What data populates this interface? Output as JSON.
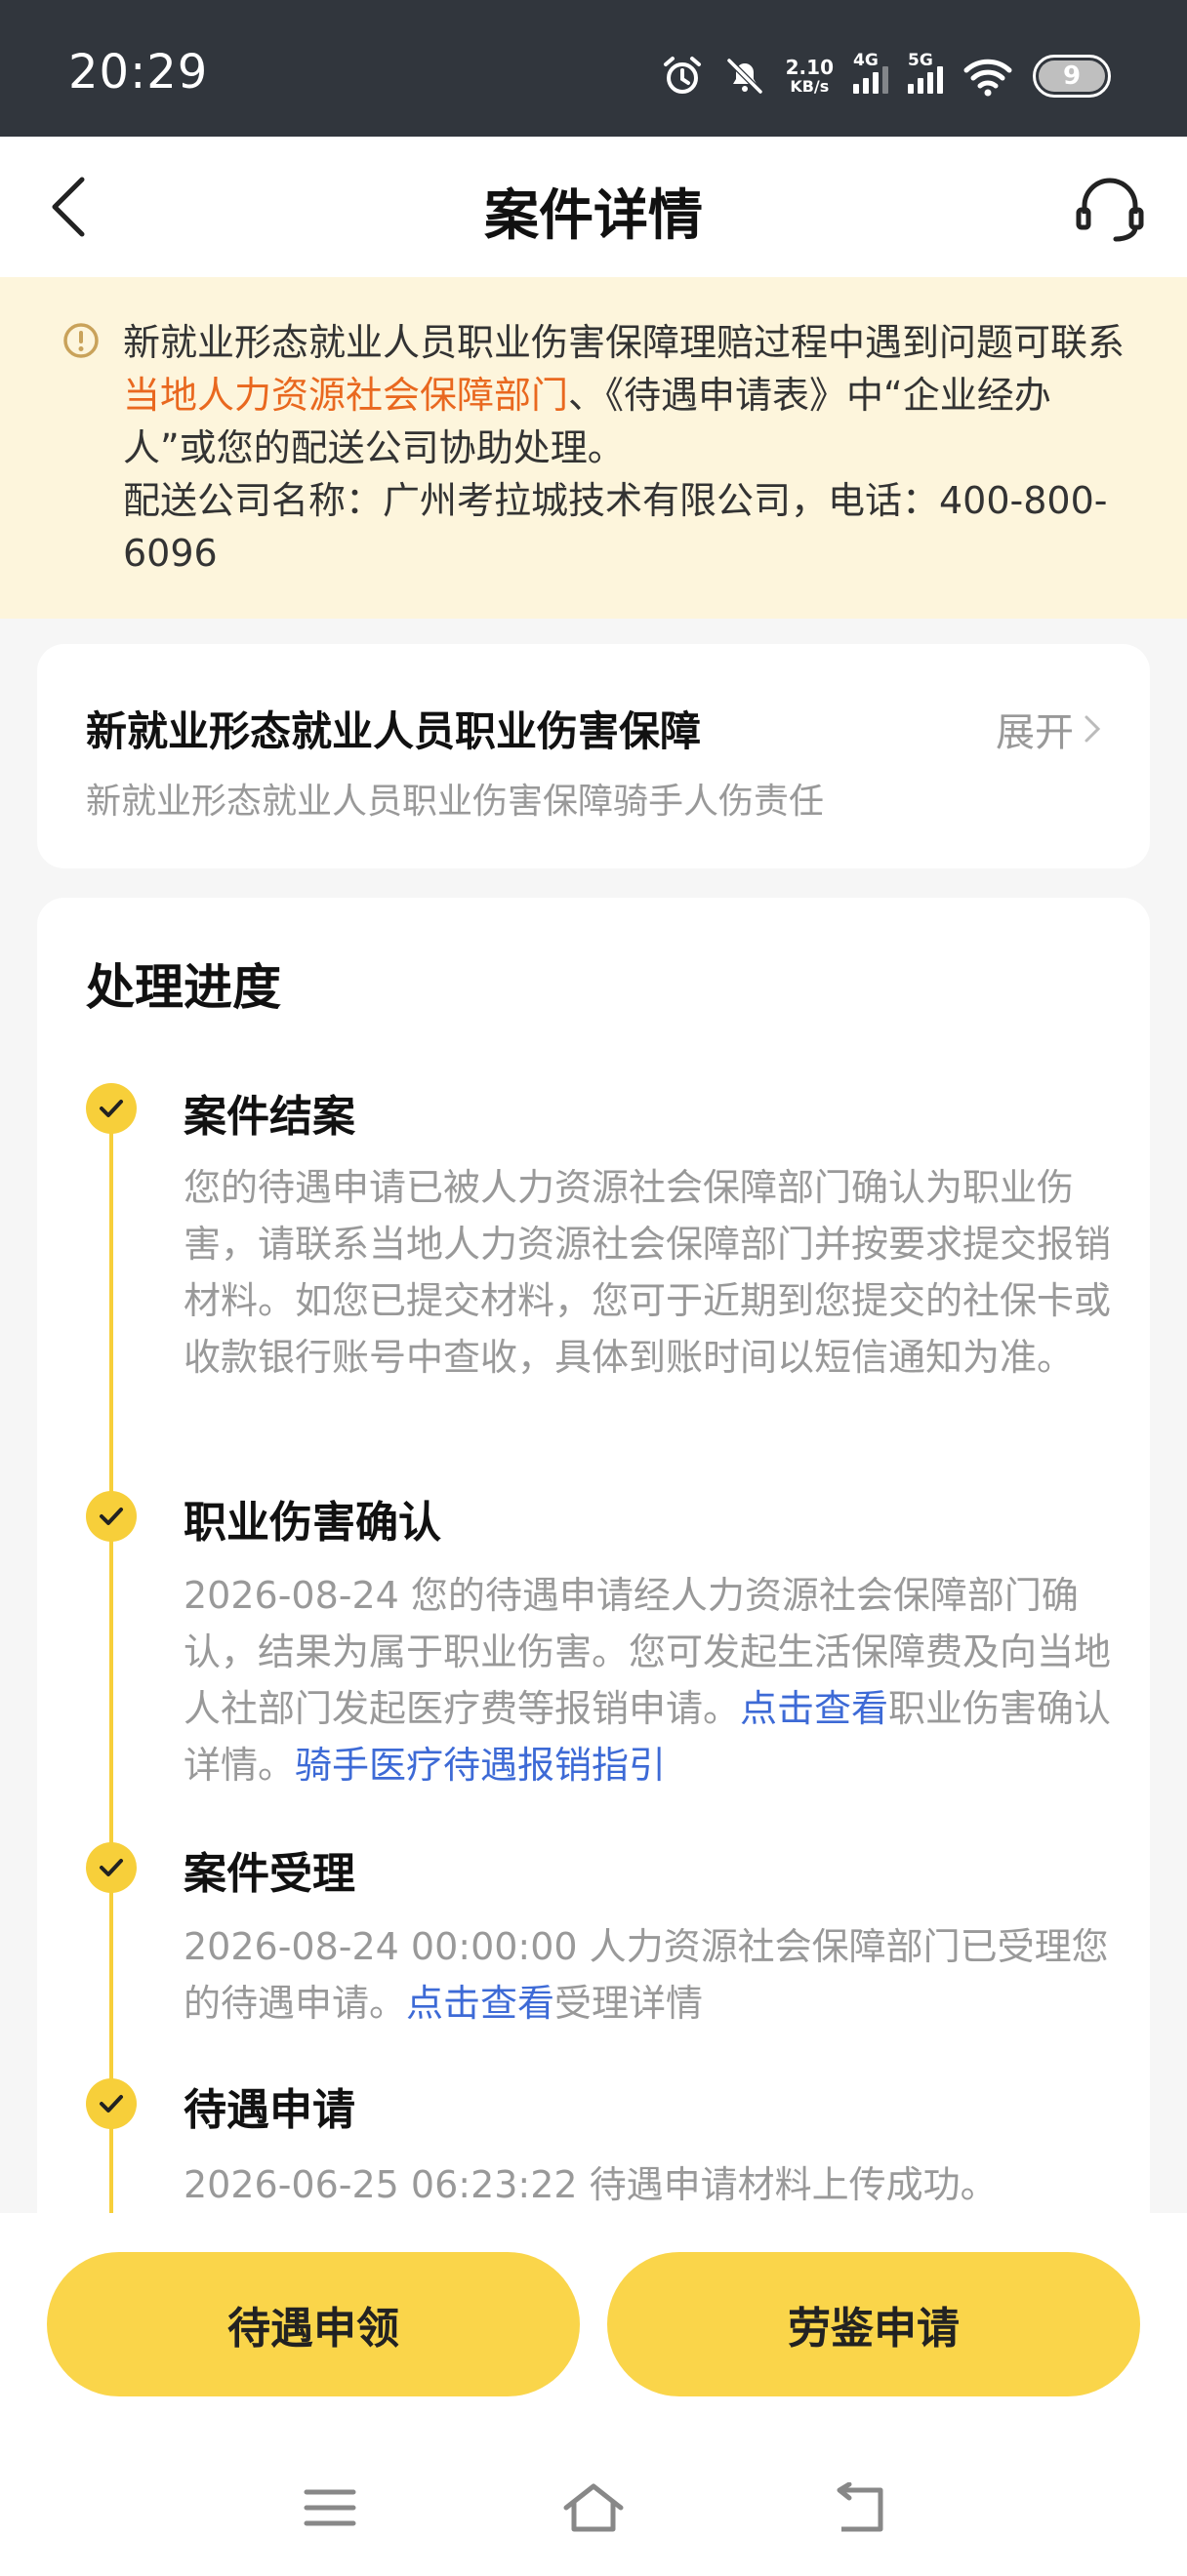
{
  "status_bar": {
    "time": "20:29",
    "net_speed_value": "2.10",
    "net_speed_unit": "KB/s",
    "signal1_label": "4G",
    "signal2_label": "5G",
    "battery": "9",
    "icons": [
      "alarm-icon",
      "mute-icon",
      "signal-4g-icon",
      "signal-5g-icon",
      "wifi-icon",
      "battery-icon"
    ]
  },
  "nav": {
    "title": "案件详情",
    "back_icon": "chevron-left-icon",
    "service_icon": "headset-icon"
  },
  "notice": {
    "text_1": "新就业形态就业人员职业伤害保障理赔过程中遇到问题可联系",
    "link": "当地人力资源社会保障部门",
    "text_2": "、《待遇申请表》中“企业经办人”或您的配送公司协助处理。",
    "company_line": "配送公司名称：广州考拉城技术有限公司，电话：400-800-6096",
    "link_color": "#e9681f",
    "background": "#fdf5dc"
  },
  "insurance_card": {
    "title": "新就业形态就业人员职业伤害保障",
    "subtitle": "新就业形态就业人员职业伤害保障骑手人伤责任",
    "expand_label": "展开"
  },
  "progress": {
    "title": "处理进度",
    "steps": [
      {
        "title": "案件结案",
        "desc": "您的待遇申请已被人力资源社会保障部门确认为职业伤害，请联系当地人力资源社会保障部门并按要求提交报销材料。如您已提交材料，您可于近期到您提交的社保卡或收款银行账号中查收，具体到账时间以短信通知为准。"
      },
      {
        "title": "职业伤害确认",
        "desc_1": "2026-08-24 您的待遇申请经人力资源社会保障部门确认，结果为属于职业伤害。您可发起生活保障费及向当地人社部门发起医疗费等报销申请。",
        "link_1": "点击查看",
        "desc_2": "职业伤害确认详情。",
        "link_2": "骑手医疗待遇报销指引"
      },
      {
        "title": "案件受理",
        "desc_1": "2026-08-24 00:00:00 人力资源社会保障部门已受理您的待遇申请。",
        "link_1": "点击查看",
        "desc_2": "受理详情"
      },
      {
        "title": "待遇申请",
        "desc": "2026-06-25 06:23:22 待遇申请材料上传成功。"
      }
    ],
    "accent_color": "#f7cf3a",
    "link_color": "#3d6ad6"
  },
  "actions": {
    "left_button": "待遇申领",
    "right_button": "劳鉴申请",
    "button_color": "#fad54a"
  },
  "system_nav": {
    "icons": [
      "menu-icon",
      "home-icon",
      "back-icon"
    ]
  }
}
